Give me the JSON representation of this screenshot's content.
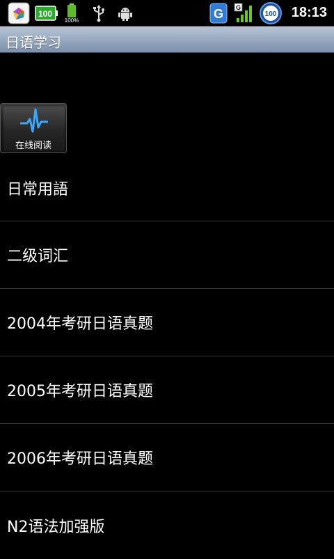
{
  "status_bar": {
    "battery_percent_label": "100%",
    "battery_box_label": "100",
    "network_type": "G",
    "signal_circle_value": "100",
    "time": "18:13",
    "icons": [
      "app-store-icon",
      "battery-full-icon",
      "battery-charging-icon",
      "usb-icon",
      "android-debug-icon",
      "g-app-icon",
      "signal-strength-icon",
      "circle-100-icon"
    ]
  },
  "app": {
    "title": "日语学习"
  },
  "online_reading_button": {
    "label": "在线阅读",
    "icon": "pulse-wave-icon"
  },
  "list": {
    "items": [
      {
        "label": "日常用語"
      },
      {
        "label": "二级词汇"
      },
      {
        "label": "2004年考研日语真题"
      },
      {
        "label": "2005年考研日语真题"
      },
      {
        "label": "2006年考研日语真题"
      },
      {
        "label": "N2语法加强版"
      }
    ]
  },
  "colors": {
    "background": "#000000",
    "title_bar": "#8a9bb5",
    "divider": "#3a3a3a",
    "accent_blue": "#2f7bd6"
  }
}
